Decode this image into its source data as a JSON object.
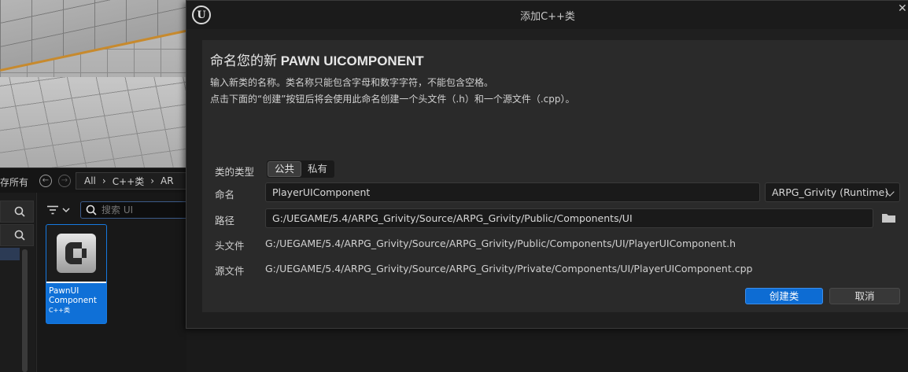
{
  "background": {
    "save_all": "存所有",
    "breadcrumbs": [
      "All",
      "C++类",
      "AR"
    ],
    "search_placeholder": "搜索 UI",
    "asset": {
      "name": "PawnUI Component",
      "type": "C++类"
    }
  },
  "dialog": {
    "title": "添加C++类",
    "heading_prefix": "命名您的新 ",
    "heading_class": "PAWN UICOMPONENT",
    "desc_line1": "输入新类的名称。类名称只能包含字母和数字字符，不能包含空格。",
    "desc_line2": "点击下面的“创建”按钮后将会使用此命名创建一个头文件（.h）和一个源文件（.cpp）。",
    "class_type_label": "类的类型",
    "class_type_options": [
      "公共",
      "私有"
    ],
    "class_type_selected": "公共",
    "name_label": "命名",
    "name_value": "PlayerUIComponent",
    "module_value": "ARPG_Grivity (Runtime)",
    "path_label": "路径",
    "path_value": "G:/UEGAME/5.4/ARPG_Grivity/Source/ARPG_Grivity/Public/Components/UI",
    "header_label": "头文件",
    "header_value": "G:/UEGAME/5.4/ARPG_Grivity/Source/ARPG_Grivity/Public/Components/UI/PlayerUIComponent.h",
    "source_label": "源文件",
    "source_value": "G:/UEGAME/5.4/ARPG_Grivity/Source/ARPG_Grivity/Private/Components/UI/PlayerUIComponent.cpp",
    "create_button": "创建类",
    "cancel_button": "取消"
  },
  "colors": {
    "accent": "#0d6cd3",
    "dialog_bg": "#1f1f1f",
    "panel_bg": "#2a2a2a"
  },
  "icons": [
    "ue-logo-icon",
    "close-icon",
    "back-icon",
    "forward-icon",
    "search-icon",
    "filter-icon",
    "chevron-down-icon",
    "folder-icon",
    "cpp-class-icon"
  ]
}
